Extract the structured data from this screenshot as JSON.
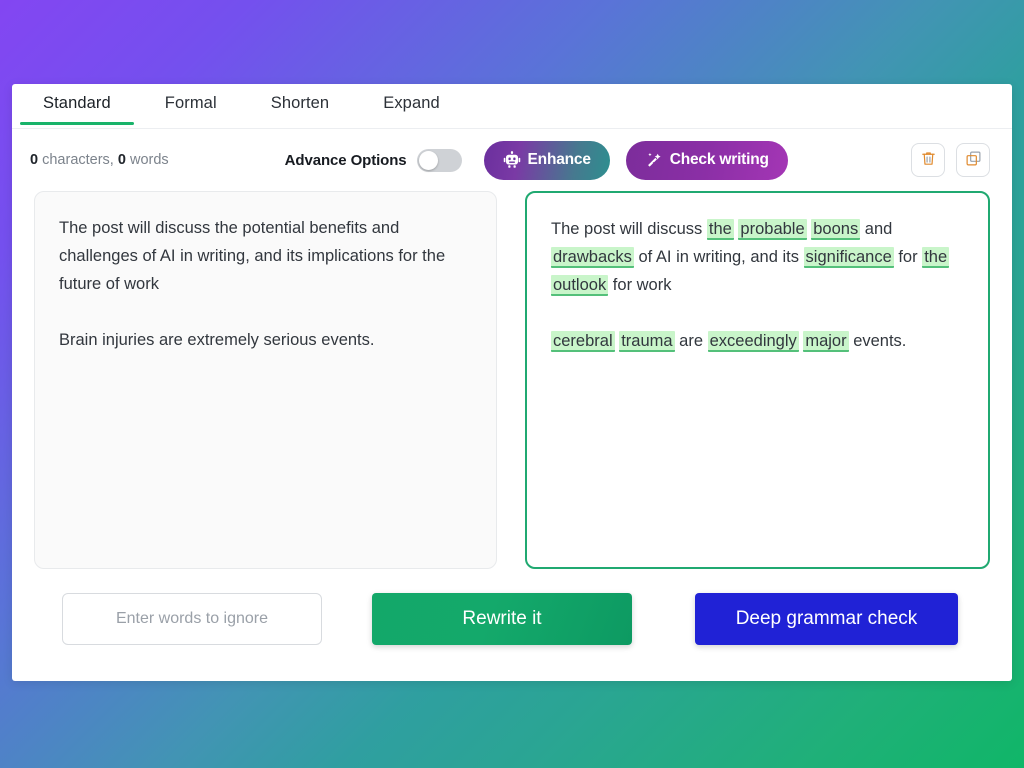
{
  "theme": {
    "gradient_from": "#8346f2",
    "gradient_mid": "#2f9fa0",
    "gradient_to": "#10b668",
    "accent_green": "#19b36a",
    "highlight_bg": "#c9f5ca",
    "highlight_underline": "#54c07a",
    "pane_border_green": "#20a971",
    "deep_blue": "#2022d6"
  },
  "tabs": [
    {
      "label": "Standard",
      "active": true
    },
    {
      "label": "Formal",
      "active": false
    },
    {
      "label": "Shorten",
      "active": false
    },
    {
      "label": "Expand",
      "active": false
    }
  ],
  "toolbar": {
    "char_count": "0",
    "char_label": "characters,",
    "word_count": "0",
    "word_label": "words",
    "advance_options_label": "Advance Options",
    "advance_options_on": false,
    "enhance_label": "Enhance",
    "enhance_icon": "robot-icon",
    "check_writing_label": "Check writing",
    "check_writing_icon": "magic-wand-icon",
    "delete_icon": "trash-icon",
    "copy_icon": "copy-icon"
  },
  "editor": {
    "source": {
      "paragraphs": [
        "The post will discuss the potential benefits and challenges of AI in writing, and its implications for the future of work",
        "Brain injuries are extremely serious events."
      ]
    },
    "result": {
      "paragraphs": [
        {
          "tokens": [
            {
              "t": "The post will discuss ",
              "hl": false
            },
            {
              "t": "the",
              "hl": true
            },
            {
              "t": " ",
              "hl": false
            },
            {
              "t": "probable",
              "hl": true
            },
            {
              "t": " ",
              "hl": false
            },
            {
              "t": "boons",
              "hl": true
            },
            {
              "t": " and ",
              "hl": false
            },
            {
              "t": "drawbacks",
              "hl": true
            },
            {
              "t": " of AI in writing, and its ",
              "hl": false
            },
            {
              "t": "significance",
              "hl": true
            },
            {
              "t": " for ",
              "hl": false
            },
            {
              "t": "the",
              "hl": true
            },
            {
              "t": " ",
              "hl": false
            },
            {
              "t": "outlook",
              "hl": true
            },
            {
              "t": " for work",
              "hl": false
            }
          ]
        },
        {
          "tokens": [
            {
              "t": "cerebral",
              "hl": true
            },
            {
              "t": " ",
              "hl": false
            },
            {
              "t": "trauma",
              "hl": true
            },
            {
              "t": " are ",
              "hl": false
            },
            {
              "t": "exceedingly",
              "hl": true
            },
            {
              "t": " ",
              "hl": false
            },
            {
              "t": "major",
              "hl": true
            },
            {
              "t": " events.",
              "hl": false
            }
          ]
        }
      ]
    }
  },
  "footer": {
    "ignore_placeholder": "Enter words to ignore",
    "ignore_value": "",
    "rewrite_label": "Rewrite it",
    "deep_grammar_label": "Deep grammar check"
  }
}
